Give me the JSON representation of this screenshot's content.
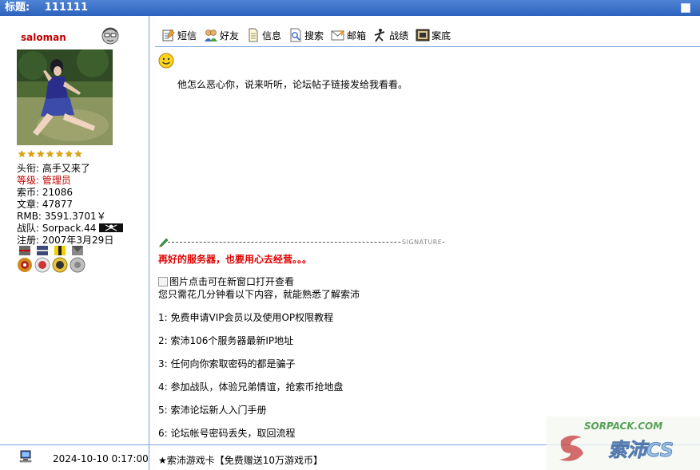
{
  "thread": {
    "title_label": "标题:",
    "title_value": "111111"
  },
  "author": {
    "username": "saloman",
    "stars": [
      "★",
      "★",
      "★",
      "★",
      "★",
      "★",
      "★"
    ],
    "fields": [
      {
        "label": "头衔:",
        "value": "高手又来了"
      },
      {
        "label": "等级:",
        "value": "管理员"
      },
      {
        "label": "索币:",
        "value": "21086"
      },
      {
        "label": "文章:",
        "value": "47877"
      },
      {
        "label": "RMB:",
        "value": "3591.3701￥"
      },
      {
        "label": "战队:",
        "value": "Sorpack.44"
      },
      {
        "label": "注册:",
        "value": "2007年3月29日"
      }
    ]
  },
  "toolbar": {
    "items": [
      {
        "label": "短信",
        "icon": "message-icon"
      },
      {
        "label": "好友",
        "icon": "friends-icon"
      },
      {
        "label": "信息",
        "icon": "info-icon"
      },
      {
        "label": "搜索",
        "icon": "search-icon"
      },
      {
        "label": "邮箱",
        "icon": "mail-icon"
      },
      {
        "label": "战绩",
        "icon": "record-icon"
      },
      {
        "label": "案底",
        "icon": "file-icon"
      }
    ]
  },
  "post": {
    "message": "他怎么恶心你，说来听听，论坛帖子链接发给我看看。"
  },
  "signature": {
    "label": "SIGNATURE",
    "slogan": "再好的服务器，也要用心去经营。。。",
    "image_alt": "图片点击可在新窗口打开查看",
    "intro": "您只需花几分钟看以下内容，就能熟悉了解索沛",
    "items": [
      "1: 免费申请VIP会员以及使用OP权限教程",
      "2: 索沛106个服务器最新IP地址",
      "3: 任何向你索取密码的都是骗子",
      "4: 参加战队，体验兄弟情谊，抢索币抢地盘",
      "5: 索沛论坛新人入门手册",
      "6: 论坛帐号密码丢失，取回流程"
    ]
  },
  "footer": {
    "post_time": "2024-10-10 0:17:00",
    "ad_text": "★索沛游戏卡【免费赠送10万游戏币】"
  },
  "watermark": {
    "text": "SORPACK.COM",
    "brand": "索沛CS"
  },
  "colors": {
    "header_blue": "#2d63bd",
    "border_blue": "#7aa3de",
    "username_red": "#c00000",
    "slogan_red": "#e00000"
  }
}
